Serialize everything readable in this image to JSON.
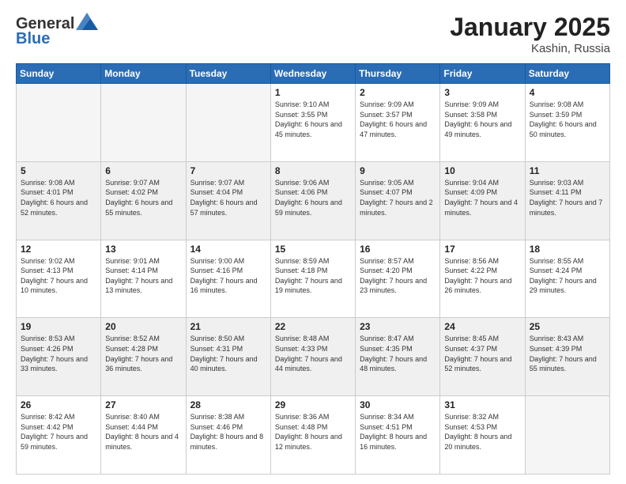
{
  "logo": {
    "general": "General",
    "blue": "Blue"
  },
  "title": {
    "month_year": "January 2025",
    "location": "Kashin, Russia"
  },
  "weekdays": [
    "Sunday",
    "Monday",
    "Tuesday",
    "Wednesday",
    "Thursday",
    "Friday",
    "Saturday"
  ],
  "weeks": [
    [
      {
        "day": "",
        "sunrise": "",
        "sunset": "",
        "daylight": ""
      },
      {
        "day": "",
        "sunrise": "",
        "sunset": "",
        "daylight": ""
      },
      {
        "day": "",
        "sunrise": "",
        "sunset": "",
        "daylight": ""
      },
      {
        "day": "1",
        "sunrise": "Sunrise: 9:10 AM",
        "sunset": "Sunset: 3:55 PM",
        "daylight": "Daylight: 6 hours and 45 minutes."
      },
      {
        "day": "2",
        "sunrise": "Sunrise: 9:09 AM",
        "sunset": "Sunset: 3:57 PM",
        "daylight": "Daylight: 6 hours and 47 minutes."
      },
      {
        "day": "3",
        "sunrise": "Sunrise: 9:09 AM",
        "sunset": "Sunset: 3:58 PM",
        "daylight": "Daylight: 6 hours and 49 minutes."
      },
      {
        "day": "4",
        "sunrise": "Sunrise: 9:08 AM",
        "sunset": "Sunset: 3:59 PM",
        "daylight": "Daylight: 6 hours and 50 minutes."
      }
    ],
    [
      {
        "day": "5",
        "sunrise": "Sunrise: 9:08 AM",
        "sunset": "Sunset: 4:01 PM",
        "daylight": "Daylight: 6 hours and 52 minutes."
      },
      {
        "day": "6",
        "sunrise": "Sunrise: 9:07 AM",
        "sunset": "Sunset: 4:02 PM",
        "daylight": "Daylight: 6 hours and 55 minutes."
      },
      {
        "day": "7",
        "sunrise": "Sunrise: 9:07 AM",
        "sunset": "Sunset: 4:04 PM",
        "daylight": "Daylight: 6 hours and 57 minutes."
      },
      {
        "day": "8",
        "sunrise": "Sunrise: 9:06 AM",
        "sunset": "Sunset: 4:06 PM",
        "daylight": "Daylight: 6 hours and 59 minutes."
      },
      {
        "day": "9",
        "sunrise": "Sunrise: 9:05 AM",
        "sunset": "Sunset: 4:07 PM",
        "daylight": "Daylight: 7 hours and 2 minutes."
      },
      {
        "day": "10",
        "sunrise": "Sunrise: 9:04 AM",
        "sunset": "Sunset: 4:09 PM",
        "daylight": "Daylight: 7 hours and 4 minutes."
      },
      {
        "day": "11",
        "sunrise": "Sunrise: 9:03 AM",
        "sunset": "Sunset: 4:11 PM",
        "daylight": "Daylight: 7 hours and 7 minutes."
      }
    ],
    [
      {
        "day": "12",
        "sunrise": "Sunrise: 9:02 AM",
        "sunset": "Sunset: 4:13 PM",
        "daylight": "Daylight: 7 hours and 10 minutes."
      },
      {
        "day": "13",
        "sunrise": "Sunrise: 9:01 AM",
        "sunset": "Sunset: 4:14 PM",
        "daylight": "Daylight: 7 hours and 13 minutes."
      },
      {
        "day": "14",
        "sunrise": "Sunrise: 9:00 AM",
        "sunset": "Sunset: 4:16 PM",
        "daylight": "Daylight: 7 hours and 16 minutes."
      },
      {
        "day": "15",
        "sunrise": "Sunrise: 8:59 AM",
        "sunset": "Sunset: 4:18 PM",
        "daylight": "Daylight: 7 hours and 19 minutes."
      },
      {
        "day": "16",
        "sunrise": "Sunrise: 8:57 AM",
        "sunset": "Sunset: 4:20 PM",
        "daylight": "Daylight: 7 hours and 23 minutes."
      },
      {
        "day": "17",
        "sunrise": "Sunrise: 8:56 AM",
        "sunset": "Sunset: 4:22 PM",
        "daylight": "Daylight: 7 hours and 26 minutes."
      },
      {
        "day": "18",
        "sunrise": "Sunrise: 8:55 AM",
        "sunset": "Sunset: 4:24 PM",
        "daylight": "Daylight: 7 hours and 29 minutes."
      }
    ],
    [
      {
        "day": "19",
        "sunrise": "Sunrise: 8:53 AM",
        "sunset": "Sunset: 4:26 PM",
        "daylight": "Daylight: 7 hours and 33 minutes."
      },
      {
        "day": "20",
        "sunrise": "Sunrise: 8:52 AM",
        "sunset": "Sunset: 4:28 PM",
        "daylight": "Daylight: 7 hours and 36 minutes."
      },
      {
        "day": "21",
        "sunrise": "Sunrise: 8:50 AM",
        "sunset": "Sunset: 4:31 PM",
        "daylight": "Daylight: 7 hours and 40 minutes."
      },
      {
        "day": "22",
        "sunrise": "Sunrise: 8:48 AM",
        "sunset": "Sunset: 4:33 PM",
        "daylight": "Daylight: 7 hours and 44 minutes."
      },
      {
        "day": "23",
        "sunrise": "Sunrise: 8:47 AM",
        "sunset": "Sunset: 4:35 PM",
        "daylight": "Daylight: 7 hours and 48 minutes."
      },
      {
        "day": "24",
        "sunrise": "Sunrise: 8:45 AM",
        "sunset": "Sunset: 4:37 PM",
        "daylight": "Daylight: 7 hours and 52 minutes."
      },
      {
        "day": "25",
        "sunrise": "Sunrise: 8:43 AM",
        "sunset": "Sunset: 4:39 PM",
        "daylight": "Daylight: 7 hours and 55 minutes."
      }
    ],
    [
      {
        "day": "26",
        "sunrise": "Sunrise: 8:42 AM",
        "sunset": "Sunset: 4:42 PM",
        "daylight": "Daylight: 7 hours and 59 minutes."
      },
      {
        "day": "27",
        "sunrise": "Sunrise: 8:40 AM",
        "sunset": "Sunset: 4:44 PM",
        "daylight": "Daylight: 8 hours and 4 minutes."
      },
      {
        "day": "28",
        "sunrise": "Sunrise: 8:38 AM",
        "sunset": "Sunset: 4:46 PM",
        "daylight": "Daylight: 8 hours and 8 minutes."
      },
      {
        "day": "29",
        "sunrise": "Sunrise: 8:36 AM",
        "sunset": "Sunset: 4:48 PM",
        "daylight": "Daylight: 8 hours and 12 minutes."
      },
      {
        "day": "30",
        "sunrise": "Sunrise: 8:34 AM",
        "sunset": "Sunset: 4:51 PM",
        "daylight": "Daylight: 8 hours and 16 minutes."
      },
      {
        "day": "31",
        "sunrise": "Sunrise: 8:32 AM",
        "sunset": "Sunset: 4:53 PM",
        "daylight": "Daylight: 8 hours and 20 minutes."
      },
      {
        "day": "",
        "sunrise": "",
        "sunset": "",
        "daylight": ""
      }
    ]
  ]
}
